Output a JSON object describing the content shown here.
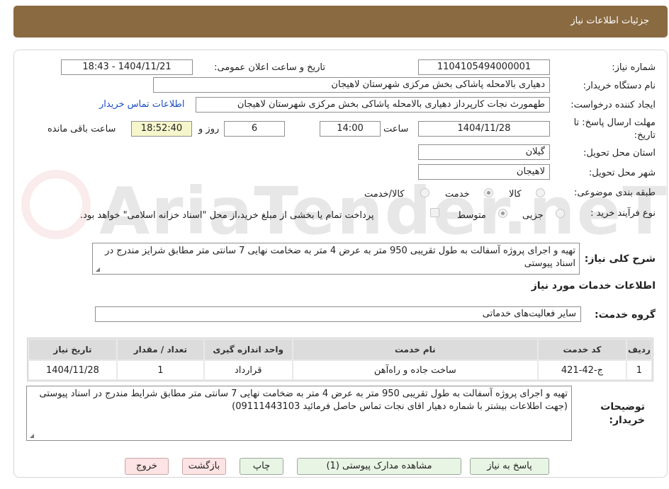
{
  "header": {
    "title": "جزئیات اطلاعات نیاز"
  },
  "form": {
    "need_number_label": "شماره نیاز:",
    "need_number": "1104105494000001",
    "announce_label": "تاریخ و ساعت اعلان عمومی:",
    "announce_value": "1404/11/21 - 18:43",
    "buyer_org_label": "نام دستگاه خریدار:",
    "buyer_org": "دهیاری بالامحله پاشاکی بخش مرکزی شهرستان لاهیجان",
    "requester_label": "ایجاد کننده درخواست:",
    "requester": "طهمورث نجات کارپرداز دهیاری بالامحله پاشاکی بخش مرکزی شهرستان لاهیجان",
    "contact_link": "اطلاعات تماس خریدار",
    "deadline_label_1": "مهلت ارسال پاسخ: تا",
    "deadline_label_2": "تاریخ:",
    "deadline_date": "1404/11/28",
    "time_label": "ساعت",
    "deadline_time": "14:00",
    "days_value": "6",
    "days_label": "روز و",
    "remaining_time": "18:52:40",
    "remaining_label": "ساعت باقی مانده",
    "province_label": "استان محل تحویل:",
    "province": "گیلان",
    "city_label": "شهر محل تحویل:",
    "city": "لاهیجان",
    "category_label": "طبقه بندی موضوعی:",
    "category_options": [
      "کالا",
      "خدمت",
      "کالا/خدمت"
    ],
    "process_label": "نوع فرآیند خرید :",
    "process_options": [
      "جزیی",
      "متوسط"
    ],
    "treasury_note": "پرداخت تمام یا بخشی از مبلغ خرید،از محل \"اسناد خزانه اسلامی\" خواهد بود."
  },
  "description": {
    "label": "شرح کلی نیاز:",
    "text": "تهیه و اجرای پروژه آسفالت به طول تقریبی  950 متر به عرض 4 متر به ضخامت نهایی 7 سانتی متر مطابق شرایز مندرج در اسناد پیوستی"
  },
  "services": {
    "section_title": "اطلاعات خدمات مورد نیاز",
    "group_label": "گروه خدمت:",
    "group_value": "سایر فعالیت‌های خدماتی",
    "columns": [
      "ردیف",
      "کد خدمت",
      "نام خدمت",
      "واحد اندازه گیری",
      "تعداد / مقدار",
      "تاریخ نیاز"
    ],
    "rows": [
      [
        "1",
        "ج-42-421",
        "ساخت جاده و راه‌آهن",
        "قرارداد",
        "1",
        "1404/11/28"
      ]
    ]
  },
  "buyer_notes": {
    "label_1": "توضیحات",
    "label_2": "خریدار:",
    "line1": "تهیه و اجرای پروژه آسفالت به طول تقریبی  950 متر به عرض 4 متر به ضخامت نهایی 7 سانتی متر مطابق شرایط مندرج در اسناد پیوستی",
    "line2": "(جهت اطلاعات بیشتر با شماره دهیار اقای نجات تماس حاصل فرمائید 09111443103)"
  },
  "buttons": {
    "reply": "پاسخ به نیاز",
    "attachments": "مشاهده مدارک پیوستی (1)",
    "print": "چاپ",
    "back": "بازگشت",
    "exit": "خروج"
  }
}
